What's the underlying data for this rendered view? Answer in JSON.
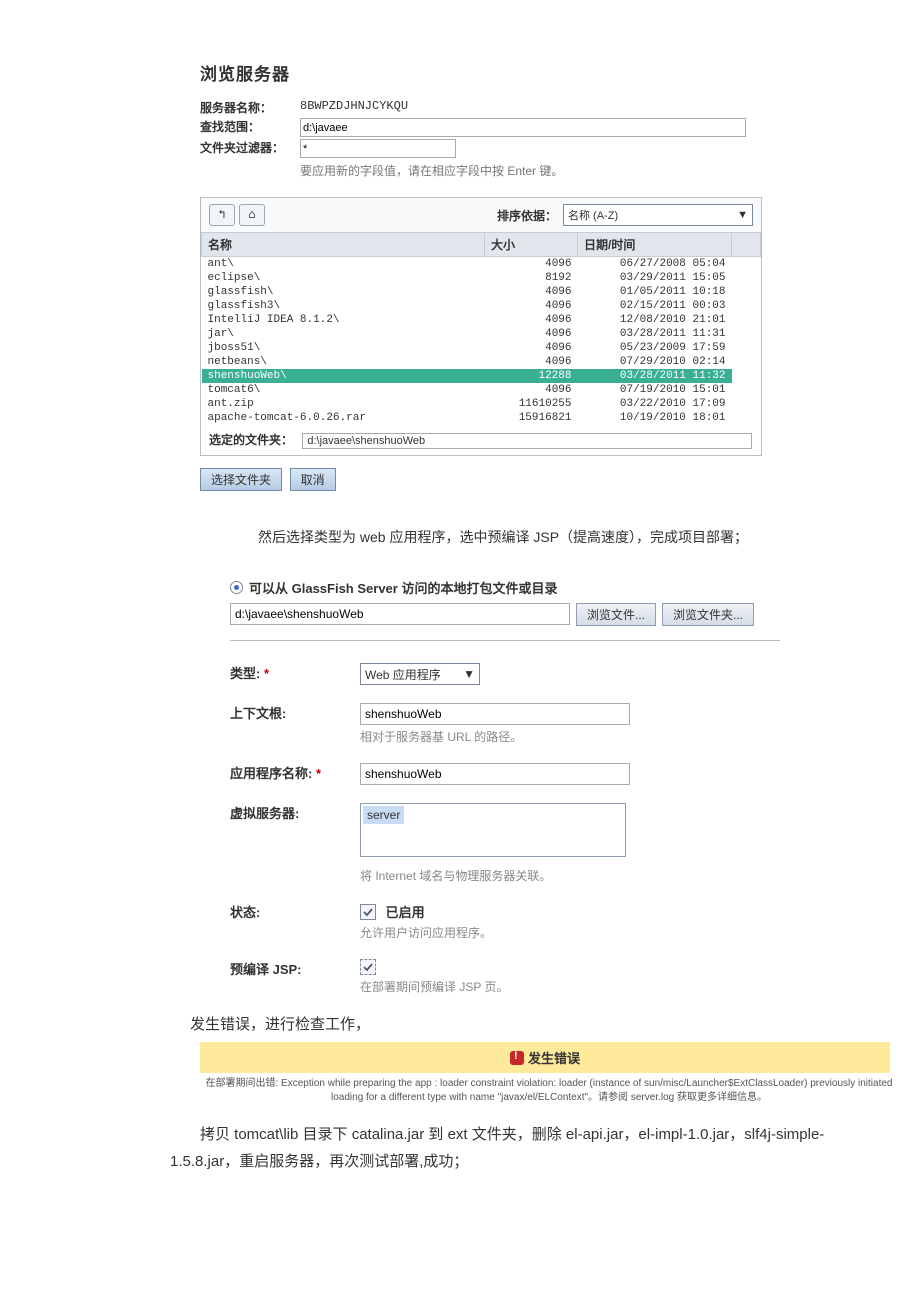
{
  "browserTitle": "浏览服务器",
  "serverInfo": {
    "nameLabel": "服务器名称：",
    "nameValue": "8BWPZDJHNJCYKQU",
    "scopeLabel": "查找范围：",
    "scopeValue": "d:\\javaee",
    "filterLabel": "文件夹过滤器：",
    "filterValue": "*",
    "hint": "要应用新的字段值，请在相应字段中按 Enter 键。"
  },
  "nav": {
    "up": "↰",
    "home": "⌂"
  },
  "sort": {
    "label": "排序依据：",
    "value": "名称 (A-Z)"
  },
  "table": {
    "headers": {
      "name": "名称",
      "size": "大小",
      "date": "日期/时间"
    },
    "rows": [
      {
        "name": "ant\\",
        "size": "4096",
        "date": "06/27/2008 05:04"
      },
      {
        "name": "eclipse\\",
        "size": "8192",
        "date": "03/29/2011 15:05"
      },
      {
        "name": "glassfish\\",
        "size": "4096",
        "date": "01/05/2011 10:18"
      },
      {
        "name": "glassfish3\\",
        "size": "4096",
        "date": "02/15/2011 00:03"
      },
      {
        "name": "IntelliJ IDEA 8.1.2\\",
        "size": "4096",
        "date": "12/08/2010 21:01"
      },
      {
        "name": "jar\\",
        "size": "4096",
        "date": "03/28/2011 11:31"
      },
      {
        "name": "jboss51\\",
        "size": "4096",
        "date": "05/23/2009 17:59"
      },
      {
        "name": "netbeans\\",
        "size": "4096",
        "date": "07/29/2010 02:14"
      },
      {
        "name": "shenshuoWeb\\",
        "size": "12288",
        "date": "03/28/2011 11:32",
        "selected": true
      },
      {
        "name": "tomcat6\\",
        "size": "4096",
        "date": "07/19/2010 15:01"
      },
      {
        "name": "ant.zip",
        "size": "11610255",
        "date": "03/22/2010 17:09"
      },
      {
        "name": "apache-tomcat-6.0.26.rar",
        "size": "15916821",
        "date": "10/19/2010 18:01"
      }
    ]
  },
  "selected": {
    "label": "选定的文件夹：",
    "value": "d:\\javaee\\shenshuoWeb"
  },
  "buttons": {
    "choose": "选择文件夹",
    "cancel": "取消"
  },
  "para1": "然后选择类型为 web 应用程序，选中预编译 JSP（提高速度），完成项目部署；",
  "radioLabel": "可以从 GlassFish Server 访问的本地打包文件或目录",
  "pathValue": "d:\\javaee\\shenshuoWeb",
  "browseBtns": {
    "file": "浏览文件...",
    "folder": "浏览文件夹..."
  },
  "form": {
    "typeLabel": "类型:",
    "typeValue": "Web 应用程序",
    "contextLabel": "上下文根:",
    "contextValue": "shenshuoWeb",
    "contextNote": "相对于服务器基 URL 的路径。",
    "appNameLabel": "应用程序名称:",
    "appNameValue": "shenshuoWeb",
    "vsLabel": "虚拟服务器:",
    "vsValue": "server",
    "vsNote": "将 Internet 域名与物理服务器关联。",
    "statusLabel": "状态:",
    "statusValue": "已启用",
    "statusNote": "允许用户访问应用程序。",
    "precompLabel": "预编译 JSP:",
    "precompNote": "在部署期间预编译 JSP 页。"
  },
  "para2": "发生错误，进行检查工作，",
  "error": {
    "title": "发生错误",
    "text": "在部署期间出错: Exception while preparing the app : loader constraint violation: loader (instance of sun/misc/Launcher$ExtClassLoader) previously initiated loading for a different type with name \"javax/el/ELContext\"。请参阅 server.log 获取更多详细信息。"
  },
  "para3": "拷贝 tomcat\\lib 目录下 catalina.jar 到 ext 文件夹，删除 el-api.jar，el-impl-1.0.jar，slf4j-simple-1.5.8.jar，重启服务器，再次测试部署,成功；"
}
